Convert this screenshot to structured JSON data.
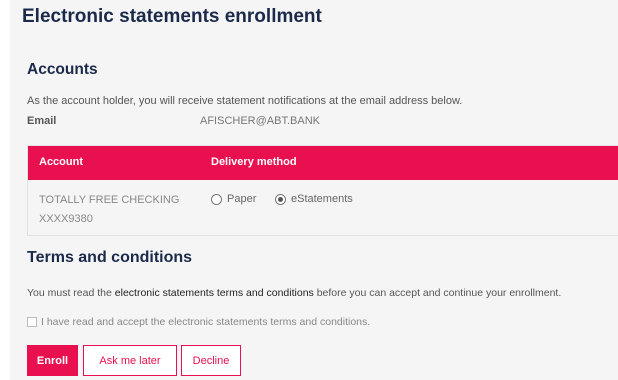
{
  "page": {
    "title": "Electronic statements enrollment"
  },
  "accounts": {
    "heading": "Accounts",
    "intro": "As the account holder, you will receive statement notifications at the email address below.",
    "email_label": "Email",
    "email_value": "AFISCHER@ABT.BANK",
    "table": {
      "columns": [
        "Account",
        "Delivery method"
      ],
      "rows": [
        {
          "account_name": "TOTALLY FREE CHECKING",
          "account_number": "XXXX9380",
          "delivery_options": [
            "Paper",
            "eStatements"
          ],
          "selected_option": "eStatements"
        }
      ]
    }
  },
  "terms": {
    "heading": "Terms and conditions",
    "text_before": "You must read the ",
    "link_text": "electronic statements terms and conditions",
    "text_after": " before you can accept and continue your enrollment.",
    "checkbox_label": "I have read and accept the electronic statements terms and conditions.",
    "checkbox_checked": false
  },
  "buttons": {
    "enroll": "Enroll",
    "later": "Ask me later",
    "decline": "Decline"
  },
  "colors": {
    "accent": "#e8104f",
    "heading": "#1b2a4a",
    "panel_background": "#f5f5f5"
  }
}
